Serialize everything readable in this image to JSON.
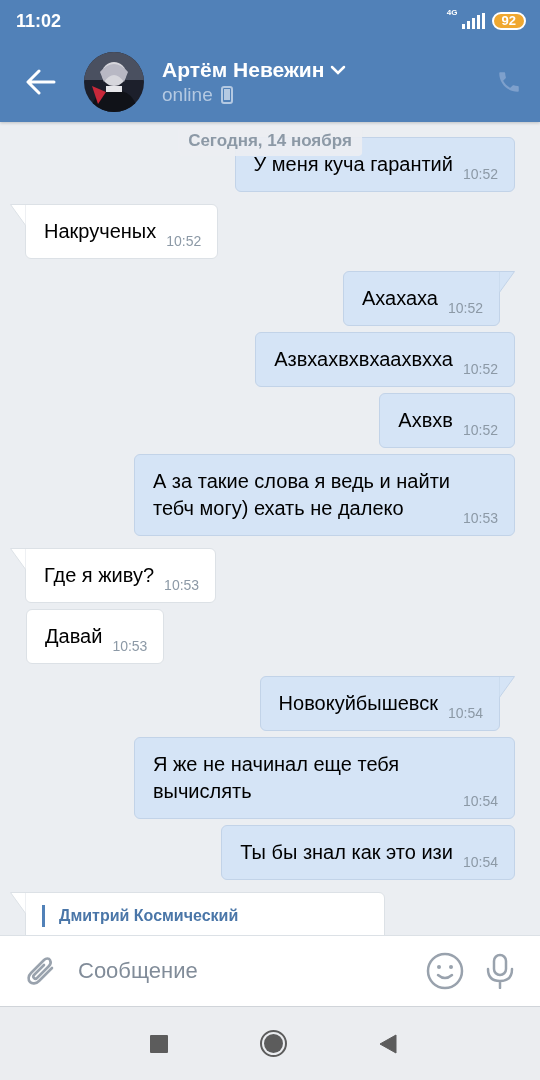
{
  "status_bar": {
    "time": "11:02",
    "network": "4G",
    "battery": "92"
  },
  "header": {
    "name": "Артём Невежин",
    "status": "online"
  },
  "date_chip": "Сегодня, 14 ноября",
  "messages": [
    {
      "outgoing": true,
      "kind": "text",
      "text": "У меня куча гарантий",
      "time": "10:52",
      "tail": false
    },
    {
      "outgoing": false,
      "kind": "text",
      "text": "Накрученых",
      "time": "10:52",
      "tail": true
    },
    {
      "outgoing": true,
      "kind": "text",
      "text": "Ахахаха",
      "time": "10:52",
      "tail": true
    },
    {
      "outgoing": true,
      "kind": "text",
      "text": "Азвхахвхвхаахвхха",
      "time": "10:52",
      "tail": false
    },
    {
      "outgoing": true,
      "kind": "text",
      "text": "Ахвхв",
      "time": "10:52",
      "tail": false
    },
    {
      "outgoing": true,
      "kind": "text",
      "text": "А за такие слова я ведь и найти тебч могу) ехать не далеко",
      "time": "10:53",
      "tail": false
    },
    {
      "outgoing": false,
      "kind": "text",
      "text": "Где я живу?",
      "time": "10:53",
      "tail": true
    },
    {
      "outgoing": false,
      "kind": "text",
      "text": "Давай",
      "time": "10:53",
      "tail": false
    },
    {
      "outgoing": true,
      "kind": "text",
      "text": "Новокуйбышевск",
      "time": "10:54",
      "tail": true
    },
    {
      "outgoing": true,
      "kind": "text",
      "text": "Я же не начинал еще тебя вычислять",
      "time": "10:54",
      "tail": false
    },
    {
      "outgoing": true,
      "kind": "text",
      "text": "Ты бы знал как это изи",
      "time": "10:54",
      "tail": false
    },
    {
      "outgoing": false,
      "kind": "reply",
      "author": "Дмитрий Космический",
      "tail": true
    }
  ],
  "composer": {
    "placeholder": "Сообщение"
  }
}
